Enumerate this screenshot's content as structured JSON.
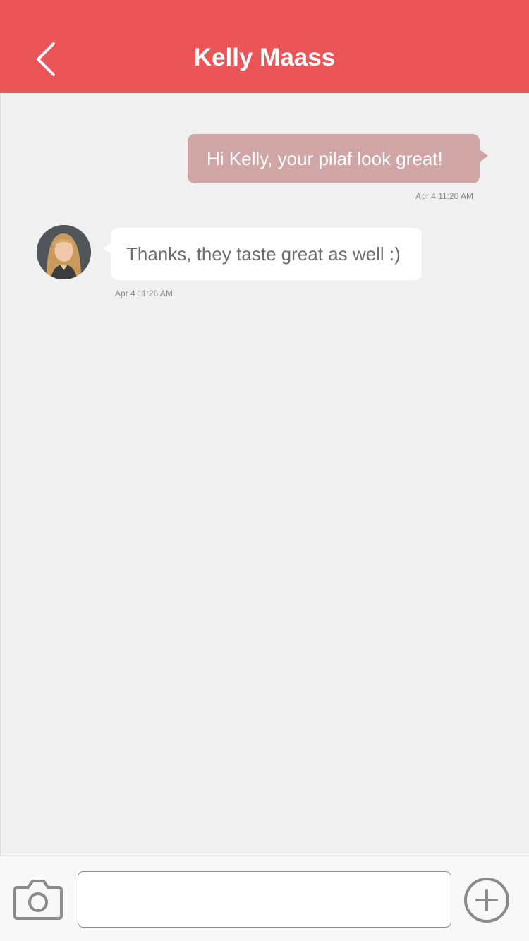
{
  "header": {
    "title": "Kelly Maass",
    "back_icon": "chevron-left-icon",
    "background": "#ec5557"
  },
  "messages": [
    {
      "direction": "outgoing",
      "text": "Hi Kelly, your pilaf look great!",
      "timestamp": "Apr 4 11:20 AM",
      "bubble_color": "#cfa5a5"
    },
    {
      "direction": "incoming",
      "text": "Thanks, they taste great as well :)",
      "timestamp": "Apr 4 11:26 AM",
      "bubble_color": "#ffffff"
    }
  ],
  "composer": {
    "camera_icon": "camera-icon",
    "input_value": "",
    "input_placeholder": "",
    "add_icon": "plus-circle-icon"
  }
}
